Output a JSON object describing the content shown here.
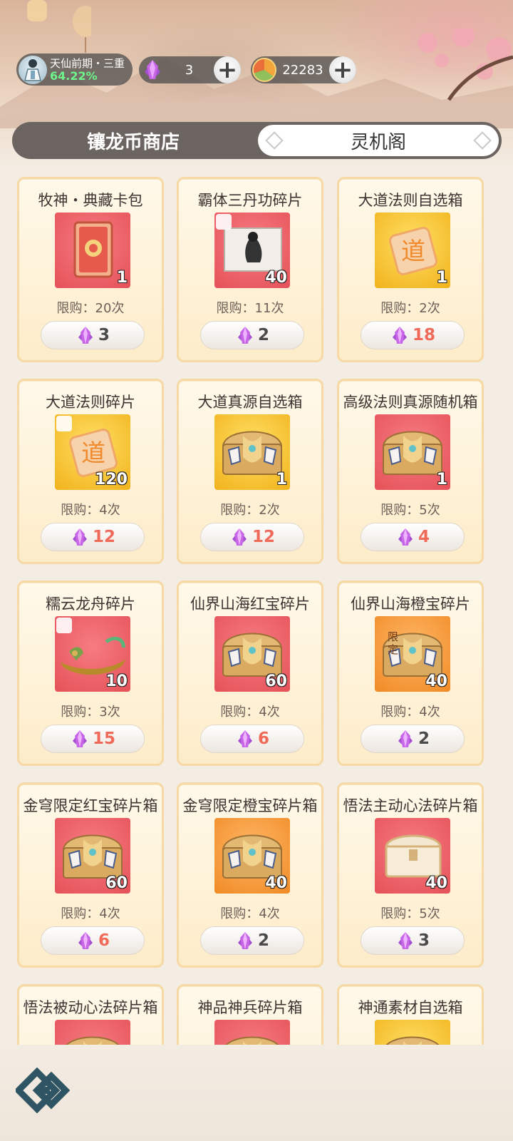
{
  "header": {
    "realm_name": "天仙前期・三重",
    "realm_progress": "64.22%",
    "gem_count": "3",
    "coin_count": "22283",
    "plus_symbol": "+"
  },
  "tabs": [
    {
      "label": "镶龙币商店",
      "active": false
    },
    {
      "label": "灵机阁",
      "active": true
    }
  ],
  "items": [
    {
      "name": "牧神・典藏卡包",
      "count": "1",
      "limit": "限购：20次",
      "price": "3",
      "price_short": false,
      "bg": "red",
      "icon": "card-pack-icon"
    },
    {
      "name": "霸体三丹功碎片",
      "count": "40",
      "limit": "限购：11次",
      "price": "2",
      "price_short": false,
      "bg": "red",
      "icon": "scroll-fragment-icon"
    },
    {
      "name": "大道法则自选箱",
      "count": "1",
      "limit": "限购：2次",
      "price": "18",
      "price_short": true,
      "bg": "gold",
      "icon": "dao-token-icon"
    },
    {
      "name": "大道法则碎片",
      "count": "120",
      "limit": "限购：4次",
      "price": "12",
      "price_short": true,
      "bg": "gold",
      "icon": "dao-fragment-icon"
    },
    {
      "name": "大道真源自选箱",
      "count": "1",
      "limit": "限购：2次",
      "price": "12",
      "price_short": true,
      "bg": "gold",
      "icon": "treasure-chest-icon"
    },
    {
      "name": "高级法则真源随机箱",
      "count": "1",
      "limit": "限购：5次",
      "price": "4",
      "price_short": true,
      "bg": "red",
      "icon": "treasure-chest-icon"
    },
    {
      "name": "糯云龙舟碎片",
      "count": "10",
      "limit": "限购：3次",
      "price": "15",
      "price_short": true,
      "bg": "red",
      "icon": "dragon-boat-fragment-icon"
    },
    {
      "name": "仙界山海红宝碎片",
      "count": "60",
      "limit": "限购：4次",
      "price": "6",
      "price_short": true,
      "bg": "red",
      "icon": "treasure-chest-icon"
    },
    {
      "name": "仙界山海橙宝碎片",
      "count": "40",
      "limit": "限购：4次",
      "price": "2",
      "price_short": false,
      "bg": "orange",
      "icon": "limited-chest-icon"
    },
    {
      "name": "金穹限定红宝碎片箱",
      "count": "60",
      "limit": "限购：4次",
      "price": "6",
      "price_short": true,
      "bg": "red",
      "icon": "treasure-chest-icon"
    },
    {
      "name": "金穹限定橙宝碎片箱",
      "count": "40",
      "limit": "限购：4次",
      "price": "2",
      "price_short": false,
      "bg": "orange",
      "icon": "treasure-chest-icon"
    },
    {
      "name": "悟法主动心法碎片箱",
      "count": "40",
      "limit": "限购：5次",
      "price": "3",
      "price_short": false,
      "bg": "red",
      "icon": "white-chest-icon"
    },
    {
      "name": "悟法被动心法碎片箱",
      "count": "",
      "limit": "",
      "price": "",
      "price_short": false,
      "bg": "red",
      "icon": "treasure-chest-icon"
    },
    {
      "name": "神品神兵碎片箱",
      "count": "",
      "limit": "",
      "price": "",
      "price_short": false,
      "bg": "red",
      "icon": "treasure-chest-icon"
    },
    {
      "name": "神通素材自选箱",
      "count": "",
      "limit": "",
      "price": "",
      "price_short": false,
      "bg": "gold",
      "icon": "treasure-chest-icon"
    }
  ],
  "labels": {
    "limited_tag": "限定",
    "dao_char": "道"
  }
}
